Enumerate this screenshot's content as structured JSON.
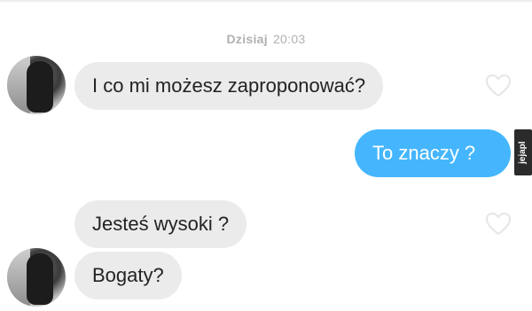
{
  "chat": {
    "timestamp": {
      "day": "Dzisiaj",
      "time": "20:03"
    },
    "messages": [
      {
        "side": "incoming",
        "text": "I co mi możesz zaproponować?"
      },
      {
        "side": "outgoing",
        "text": "To znaczy ?"
      },
      {
        "side": "incoming",
        "text": "Jesteś wysoki ?"
      },
      {
        "side": "incoming",
        "text": "Bogaty?"
      }
    ]
  },
  "watermark": {
    "text": "jejapl"
  },
  "colors": {
    "incoming_bubble": "#ebebeb",
    "outgoing_bubble": "#45b6fe",
    "timestamp": "#b0b0b0"
  },
  "icons": {
    "like": "heart-outline-icon",
    "avatar": "profile-photo"
  }
}
